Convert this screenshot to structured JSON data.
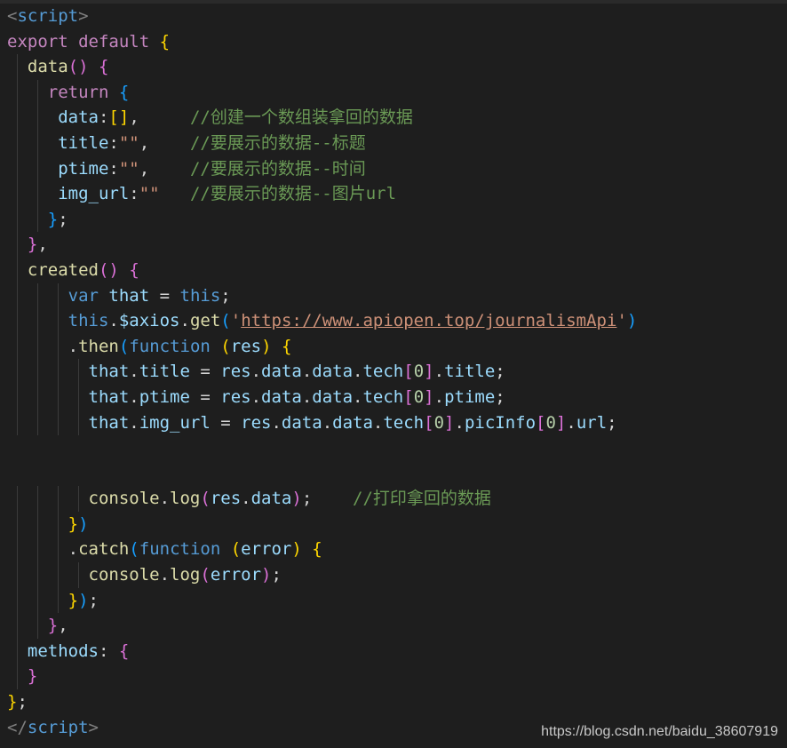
{
  "colors": {
    "background": "#1e1e1e",
    "tag_bracket": "#808080",
    "tag_name": "#569cd6",
    "keyword": "#c586c0",
    "function": "#dcdcaa",
    "property": "#9cdcfe",
    "string": "#ce9178",
    "comment": "#6a9955",
    "plain": "#d4d4d4",
    "number": "#b5cea8",
    "bracket_gold": "#ffd700",
    "bracket_purple": "#da70d6",
    "bracket_blue": "#179fff",
    "storage": "#569cd6"
  },
  "code_lines": [
    [
      {
        "t": "<",
        "c": "tag_bracket"
      },
      {
        "t": "script",
        "c": "tag_name"
      },
      {
        "t": ">",
        "c": "tag_bracket"
      }
    ],
    [
      {
        "t": "export",
        "c": "keyword"
      },
      {
        "t": " ",
        "c": "plain"
      },
      {
        "t": "default",
        "c": "keyword"
      },
      {
        "t": " ",
        "c": "plain"
      },
      {
        "t": "{",
        "c": "bracket_gold"
      }
    ],
    [
      {
        "t": "  ",
        "c": "plain"
      },
      {
        "t": "data",
        "c": "function"
      },
      {
        "t": "()",
        "c": "bracket_purple"
      },
      {
        "t": " ",
        "c": "plain"
      },
      {
        "t": "{",
        "c": "bracket_purple"
      }
    ],
    [
      {
        "t": "    ",
        "c": "plain"
      },
      {
        "t": "return",
        "c": "keyword"
      },
      {
        "t": " ",
        "c": "plain"
      },
      {
        "t": "{",
        "c": "bracket_blue"
      }
    ],
    [
      {
        "t": "     ",
        "c": "plain"
      },
      {
        "t": "data",
        "c": "property"
      },
      {
        "t": ":",
        "c": "plain"
      },
      {
        "t": "[]",
        "c": "bracket_gold"
      },
      {
        "t": ",     ",
        "c": "plain"
      },
      {
        "t": "//创建一个数组装拿回的数据",
        "c": "comment"
      }
    ],
    [
      {
        "t": "     ",
        "c": "plain"
      },
      {
        "t": "title",
        "c": "property"
      },
      {
        "t": ":",
        "c": "plain"
      },
      {
        "t": "\"\"",
        "c": "string"
      },
      {
        "t": ",    ",
        "c": "plain"
      },
      {
        "t": "//要展示的数据--标题",
        "c": "comment"
      }
    ],
    [
      {
        "t": "     ",
        "c": "plain"
      },
      {
        "t": "ptime",
        "c": "property"
      },
      {
        "t": ":",
        "c": "plain"
      },
      {
        "t": "\"\"",
        "c": "string"
      },
      {
        "t": ",    ",
        "c": "plain"
      },
      {
        "t": "//要展示的数据--时间",
        "c": "comment"
      }
    ],
    [
      {
        "t": "     ",
        "c": "plain"
      },
      {
        "t": "img_url",
        "c": "property"
      },
      {
        "t": ":",
        "c": "plain"
      },
      {
        "t": "\"\"",
        "c": "string"
      },
      {
        "t": "   ",
        "c": "plain"
      },
      {
        "t": "//要展示的数据--图片url",
        "c": "comment"
      }
    ],
    [
      {
        "t": "    ",
        "c": "plain"
      },
      {
        "t": "}",
        "c": "bracket_blue"
      },
      {
        "t": ";",
        "c": "plain"
      }
    ],
    [
      {
        "t": "  ",
        "c": "plain"
      },
      {
        "t": "}",
        "c": "bracket_purple"
      },
      {
        "t": ",",
        "c": "plain"
      }
    ],
    [
      {
        "t": "  ",
        "c": "plain"
      },
      {
        "t": "created",
        "c": "function"
      },
      {
        "t": "()",
        "c": "bracket_purple"
      },
      {
        "t": " ",
        "c": "plain"
      },
      {
        "t": "{",
        "c": "bracket_purple"
      }
    ],
    [
      {
        "t": "      ",
        "c": "plain"
      },
      {
        "t": "var",
        "c": "storage"
      },
      {
        "t": " ",
        "c": "plain"
      },
      {
        "t": "that",
        "c": "property"
      },
      {
        "t": " = ",
        "c": "plain"
      },
      {
        "t": "this",
        "c": "storage"
      },
      {
        "t": ";",
        "c": "plain"
      }
    ],
    [
      {
        "t": "      ",
        "c": "plain"
      },
      {
        "t": "this",
        "c": "storage"
      },
      {
        "t": ".",
        "c": "plain"
      },
      {
        "t": "$axios",
        "c": "property"
      },
      {
        "t": ".",
        "c": "plain"
      },
      {
        "t": "get",
        "c": "function"
      },
      {
        "t": "(",
        "c": "bracket_blue"
      },
      {
        "t": "'",
        "c": "string"
      },
      {
        "t": "https://www.apiopen.top/journalismApi",
        "c": "string",
        "u": true
      },
      {
        "t": "'",
        "c": "string"
      },
      {
        "t": ")",
        "c": "bracket_blue"
      }
    ],
    [
      {
        "t": "      ",
        "c": "plain"
      },
      {
        "t": ".",
        "c": "plain"
      },
      {
        "t": "then",
        "c": "function"
      },
      {
        "t": "(",
        "c": "bracket_blue"
      },
      {
        "t": "function",
        "c": "storage"
      },
      {
        "t": " ",
        "c": "plain"
      },
      {
        "t": "(",
        "c": "bracket_gold"
      },
      {
        "t": "res",
        "c": "property"
      },
      {
        "t": ")",
        "c": "bracket_gold"
      },
      {
        "t": " ",
        "c": "plain"
      },
      {
        "t": "{",
        "c": "bracket_gold"
      }
    ],
    [
      {
        "t": "        ",
        "c": "plain"
      },
      {
        "t": "that",
        "c": "property"
      },
      {
        "t": ".",
        "c": "plain"
      },
      {
        "t": "title",
        "c": "property"
      },
      {
        "t": " = ",
        "c": "plain"
      },
      {
        "t": "res",
        "c": "property"
      },
      {
        "t": ".",
        "c": "plain"
      },
      {
        "t": "data",
        "c": "property"
      },
      {
        "t": ".",
        "c": "plain"
      },
      {
        "t": "data",
        "c": "property"
      },
      {
        "t": ".",
        "c": "plain"
      },
      {
        "t": "tech",
        "c": "property"
      },
      {
        "t": "[",
        "c": "bracket_purple"
      },
      {
        "t": "0",
        "c": "number"
      },
      {
        "t": "]",
        "c": "bracket_purple"
      },
      {
        "t": ".",
        "c": "plain"
      },
      {
        "t": "title",
        "c": "property"
      },
      {
        "t": ";",
        "c": "plain"
      }
    ],
    [
      {
        "t": "        ",
        "c": "plain"
      },
      {
        "t": "that",
        "c": "property"
      },
      {
        "t": ".",
        "c": "plain"
      },
      {
        "t": "ptime",
        "c": "property"
      },
      {
        "t": " = ",
        "c": "plain"
      },
      {
        "t": "res",
        "c": "property"
      },
      {
        "t": ".",
        "c": "plain"
      },
      {
        "t": "data",
        "c": "property"
      },
      {
        "t": ".",
        "c": "plain"
      },
      {
        "t": "data",
        "c": "property"
      },
      {
        "t": ".",
        "c": "plain"
      },
      {
        "t": "tech",
        "c": "property"
      },
      {
        "t": "[",
        "c": "bracket_purple"
      },
      {
        "t": "0",
        "c": "number"
      },
      {
        "t": "]",
        "c": "bracket_purple"
      },
      {
        "t": ".",
        "c": "plain"
      },
      {
        "t": "ptime",
        "c": "property"
      },
      {
        "t": ";",
        "c": "plain"
      }
    ],
    [
      {
        "t": "        ",
        "c": "plain"
      },
      {
        "t": "that",
        "c": "property"
      },
      {
        "t": ".",
        "c": "plain"
      },
      {
        "t": "img_url",
        "c": "property"
      },
      {
        "t": " = ",
        "c": "plain"
      },
      {
        "t": "res",
        "c": "property"
      },
      {
        "t": ".",
        "c": "plain"
      },
      {
        "t": "data",
        "c": "property"
      },
      {
        "t": ".",
        "c": "plain"
      },
      {
        "t": "data",
        "c": "property"
      },
      {
        "t": ".",
        "c": "plain"
      },
      {
        "t": "tech",
        "c": "property"
      },
      {
        "t": "[",
        "c": "bracket_purple"
      },
      {
        "t": "0",
        "c": "number"
      },
      {
        "t": "]",
        "c": "bracket_purple"
      },
      {
        "t": ".",
        "c": "plain"
      },
      {
        "t": "picInfo",
        "c": "property"
      },
      {
        "t": "[",
        "c": "bracket_purple"
      },
      {
        "t": "0",
        "c": "number"
      },
      {
        "t": "]",
        "c": "bracket_purple"
      },
      {
        "t": ".",
        "c": "plain"
      },
      {
        "t": "url",
        "c": "property"
      },
      {
        "t": ";",
        "c": "plain"
      }
    ],
    [],
    [],
    [
      {
        "t": "        ",
        "c": "plain"
      },
      {
        "t": "console",
        "c": "function"
      },
      {
        "t": ".",
        "c": "plain"
      },
      {
        "t": "log",
        "c": "function"
      },
      {
        "t": "(",
        "c": "bracket_purple"
      },
      {
        "t": "res",
        "c": "property"
      },
      {
        "t": ".",
        "c": "plain"
      },
      {
        "t": "data",
        "c": "property"
      },
      {
        "t": ")",
        "c": "bracket_purple"
      },
      {
        "t": ";    ",
        "c": "plain"
      },
      {
        "t": "//打印拿回的数据",
        "c": "comment"
      }
    ],
    [
      {
        "t": "      ",
        "c": "plain"
      },
      {
        "t": "}",
        "c": "bracket_gold"
      },
      {
        "t": ")",
        "c": "bracket_blue"
      }
    ],
    [
      {
        "t": "      ",
        "c": "plain"
      },
      {
        "t": ".",
        "c": "plain"
      },
      {
        "t": "catch",
        "c": "function"
      },
      {
        "t": "(",
        "c": "bracket_blue"
      },
      {
        "t": "function",
        "c": "storage"
      },
      {
        "t": " ",
        "c": "plain"
      },
      {
        "t": "(",
        "c": "bracket_gold"
      },
      {
        "t": "error",
        "c": "property"
      },
      {
        "t": ")",
        "c": "bracket_gold"
      },
      {
        "t": " ",
        "c": "plain"
      },
      {
        "t": "{",
        "c": "bracket_gold"
      }
    ],
    [
      {
        "t": "        ",
        "c": "plain"
      },
      {
        "t": "console",
        "c": "function"
      },
      {
        "t": ".",
        "c": "plain"
      },
      {
        "t": "log",
        "c": "function"
      },
      {
        "t": "(",
        "c": "bracket_purple"
      },
      {
        "t": "error",
        "c": "property"
      },
      {
        "t": ")",
        "c": "bracket_purple"
      },
      {
        "t": ";",
        "c": "plain"
      }
    ],
    [
      {
        "t": "      ",
        "c": "plain"
      },
      {
        "t": "}",
        "c": "bracket_gold"
      },
      {
        "t": ")",
        "c": "bracket_blue"
      },
      {
        "t": ";",
        "c": "plain"
      }
    ],
    [
      {
        "t": "    ",
        "c": "plain"
      },
      {
        "t": "}",
        "c": "bracket_purple"
      },
      {
        "t": ",",
        "c": "plain"
      }
    ],
    [
      {
        "t": "  ",
        "c": "plain"
      },
      {
        "t": "methods",
        "c": "property"
      },
      {
        "t": ": ",
        "c": "plain"
      },
      {
        "t": "{",
        "c": "bracket_purple"
      }
    ],
    [
      {
        "t": "  ",
        "c": "plain"
      },
      {
        "t": "}",
        "c": "bracket_purple"
      }
    ],
    [
      {
        "t": "}",
        "c": "bracket_gold"
      },
      {
        "t": ";",
        "c": "plain"
      }
    ],
    [
      {
        "t": "</",
        "c": "tag_bracket"
      },
      {
        "t": "script",
        "c": "tag_name"
      },
      {
        "t": ">",
        "c": "tag_bracket"
      }
    ]
  ],
  "watermark": "https://blog.csdn.net/baidu_38607919"
}
